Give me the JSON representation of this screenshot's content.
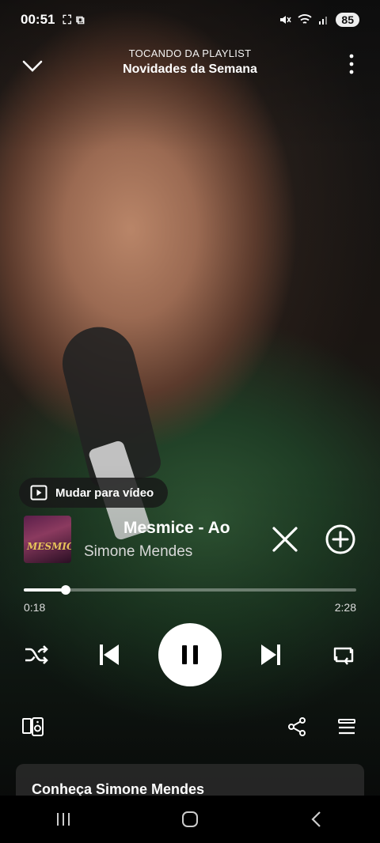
{
  "status_bar": {
    "time": "00:51",
    "battery": "85"
  },
  "header": {
    "subtitle": "TOCANDO DA PLAYLIST",
    "title": "Novidades da Semana"
  },
  "video_toggle": {
    "label": "Mudar para vídeo"
  },
  "track": {
    "title": "Mesmice - Ao",
    "artist": "Simone Mendes",
    "album_art_text": "MESMICE"
  },
  "playback": {
    "elapsed": "0:18",
    "total": "2:28",
    "progress": 0.127
  },
  "card": {
    "title": "Conheça Simone Mendes"
  },
  "icons": {
    "collapse": "chevron-down-icon",
    "more": "more-vertical-icon",
    "play_video": "play-square-icon",
    "remove": "close-icon",
    "add": "add-circle-icon",
    "shuffle": "shuffle-icon",
    "previous": "skip-previous-icon",
    "pause": "pause-icon",
    "next": "skip-next-icon",
    "repeat": "repeat-icon",
    "devices": "devices-icon",
    "share": "share-icon",
    "queue": "queue-icon"
  },
  "colors": {
    "accent": "#ffffff",
    "track_bg": "#5a5a5a"
  }
}
